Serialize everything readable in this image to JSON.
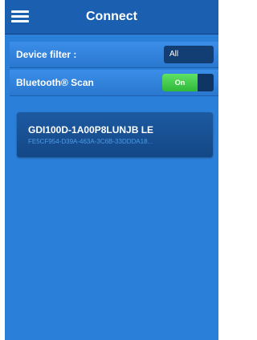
{
  "header": {
    "title": "Connect",
    "menu_icon": "menu-icon"
  },
  "settings": {
    "device_filter": {
      "label": "Device filter :",
      "value": "All"
    },
    "bluetooth_scan": {
      "label": "Bluetooth® Scan",
      "toggle_text": "On",
      "state_on": true
    }
  },
  "devices": [
    {
      "name": "GDI100D-1A00P8LUNJB LE",
      "id": "FE5CF954-D39A-463A-3C6B-33DDDA18..."
    }
  ],
  "colors": {
    "background": "#2a7fd8",
    "header": "#1b5fb0",
    "device_card": "#1d5aa2",
    "toggle_on": "#2fb838"
  }
}
